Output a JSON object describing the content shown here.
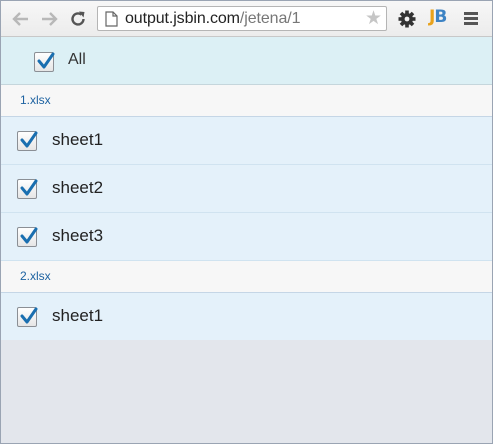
{
  "browser": {
    "url_host": "output.jsbin.com",
    "url_path": "/jetena/1",
    "icons": [
      "back-arrow-icon",
      "forward-arrow-icon",
      "reload-icon",
      "page-icon",
      "star-icon",
      "gear-icon",
      "jsbin-logo",
      "hamburger-menu-icon"
    ]
  },
  "select_all": {
    "label": "All",
    "checked": true
  },
  "files": [
    {
      "name": "1.xlsx",
      "sheets": [
        {
          "label": "sheet1",
          "checked": true
        },
        {
          "label": "sheet2",
          "checked": true
        },
        {
          "label": "sheet3",
          "checked": true
        }
      ]
    },
    {
      "name": "2.xlsx",
      "sheets": [
        {
          "label": "sheet1",
          "checked": true
        }
      ]
    }
  ],
  "colors": {
    "check": "#1a6fb0",
    "file_label": "#1d62a1",
    "row_bg": "#e4f1fa",
    "all_bg": "#dcf0f5"
  }
}
